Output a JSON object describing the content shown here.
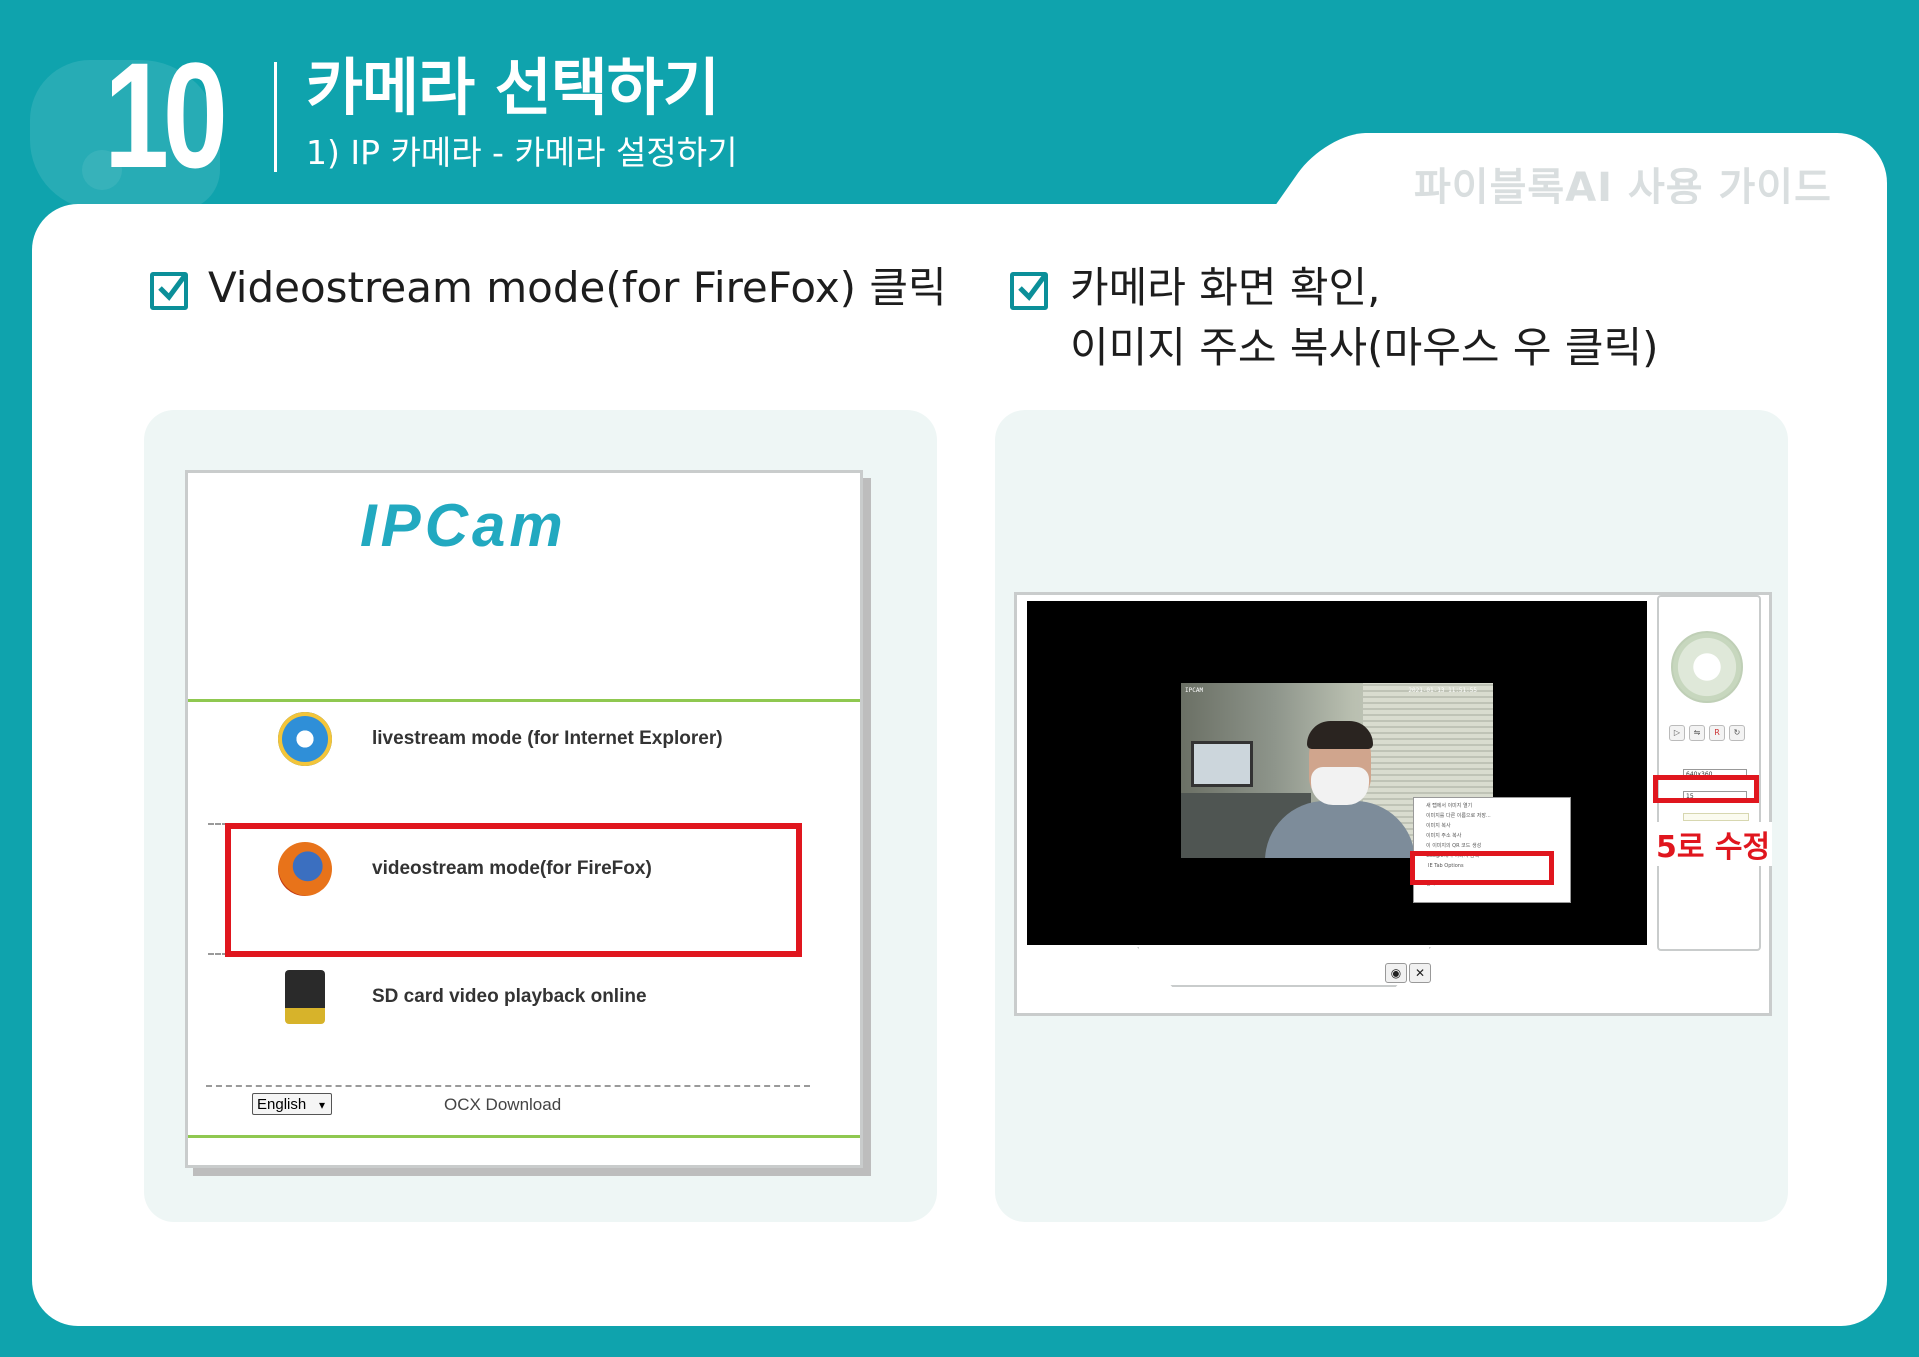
{
  "header": {
    "page_number": "10",
    "title": "카메라 선택하기",
    "subtitle": "1) IP 카메라 - 카메라 설정하기",
    "guide_label": "파이블록AI 사용 가이드"
  },
  "left_step": {
    "instruction": "Videostream mode(for FireFox) 클릭",
    "screenshot": {
      "logo": "IPCam",
      "modes": [
        {
          "label": "livestream mode (for Internet Explorer)",
          "icon": "internet-explorer-icon"
        },
        {
          "label": "videostream mode(for FireFox)",
          "icon": "firefox-icon",
          "highlighted": true
        },
        {
          "label": "SD card video playback online",
          "icon": "sd-card-icon"
        }
      ],
      "language_select": "English",
      "ocx_link": "OCX Download"
    }
  },
  "right_step": {
    "instruction_line1": "카메라 화면 확인,",
    "instruction_line2": "이미지 주소 복사(마우스 우 클릭)",
    "screenshot": {
      "video_overlay_left": "IPCAM",
      "video_overlay_right": "2021-01-13 11:51:55",
      "context_menu_items": [
        "새 탭에서 이미지 열기",
        "이미지를 다른 이름으로 저장...",
        "이미지 복사",
        "이미지 주소 복사",
        "이 이미지의 QR 코드 생성",
        "Google에서 이미지 검색",
        "IE Tab Options",
        "검사"
      ],
      "context_menu_shortcut": "Ctrl+Shift+I",
      "resolution_select": "640x360",
      "quality_select": "15",
      "fix_label": "5로 수정"
    }
  },
  "colors": {
    "teal_background": "#0fa3ad",
    "panel_background": "#eef6f5",
    "highlight_red": "#e0161e",
    "check_teal": "#0b8f99"
  }
}
